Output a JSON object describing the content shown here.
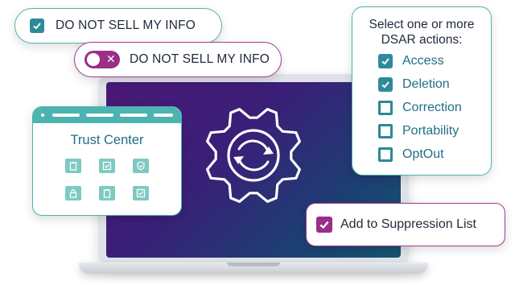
{
  "dns_checkbox_pill": {
    "label": "DO NOT SELL MY INFO",
    "checked": true
  },
  "dns_toggle_pill": {
    "label": "DO NOT SELL MY INFO",
    "toggle_state": "off"
  },
  "dsar_card": {
    "title_line1": "Select one or more",
    "title_line2": "DSAR actions:",
    "items": [
      {
        "label": "Access",
        "checked": true
      },
      {
        "label": "Deletion",
        "checked": true
      },
      {
        "label": "Correction",
        "checked": false
      },
      {
        "label": "Portability",
        "checked": false
      },
      {
        "label": "OptOut",
        "checked": false
      }
    ]
  },
  "trust_center": {
    "title": "Trust Center",
    "tiles": [
      "clipboard-icon",
      "check-box-icon",
      "shield-check-icon",
      "lock-icon",
      "clipboard-icon",
      "check-box-icon"
    ]
  },
  "suppression_card": {
    "label": "Add to Suppression List",
    "checked": true
  },
  "center_icon": "gear-sync-icon",
  "colors": {
    "teal": "#4db3b0",
    "teal_dark": "#2e8a9a",
    "purple": "#9a2e88",
    "screen_gradient_start": "#4a1877",
    "screen_gradient_end": "#165570"
  }
}
